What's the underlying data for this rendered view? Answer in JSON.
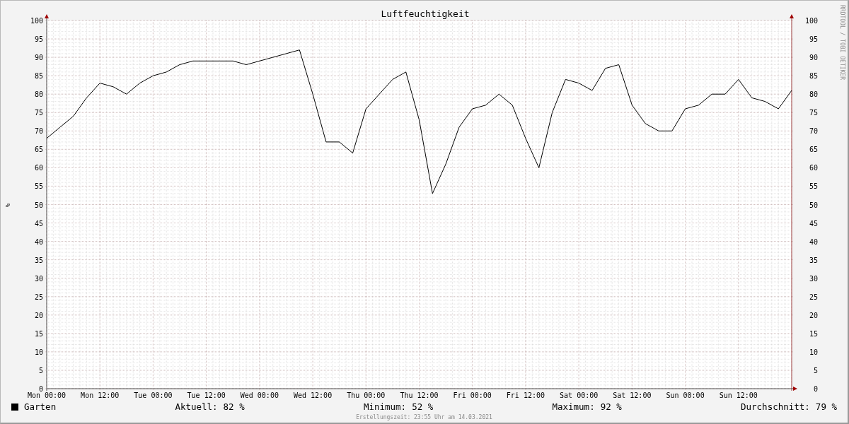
{
  "credit": "RRDTOOL / TOBI OETIKER",
  "chart_data": {
    "type": "line",
    "title": "Luftfeuchtigkeit",
    "ylabel": "%",
    "ylim": [
      0,
      100
    ],
    "grid": true,
    "yticks": [
      0,
      5,
      10,
      15,
      20,
      25,
      30,
      35,
      40,
      45,
      50,
      55,
      60,
      65,
      70,
      75,
      80,
      85,
      90,
      95,
      100
    ],
    "categories": [
      "Mon 00:00",
      null,
      null,
      null,
      "Mon 12:00",
      null,
      null,
      null,
      "Tue 00:00",
      null,
      null,
      null,
      "Tue 12:00",
      null,
      null,
      null,
      "Wed 00:00",
      null,
      null,
      null,
      "Wed 12:00",
      null,
      null,
      null,
      "Thu 00:00",
      null,
      null,
      null,
      "Thu 12:00",
      null,
      null,
      null,
      "Fri 00:00",
      null,
      null,
      null,
      "Fri 12:00",
      null,
      null,
      null,
      "Sat 00:00",
      null,
      null,
      null,
      "Sat 12:00",
      null,
      null,
      null,
      "Sun 00:00",
      null,
      null,
      null,
      "Sun 12:00",
      null,
      null,
      null,
      null
    ],
    "series": [
      {
        "name": "Garten",
        "color": "#000000",
        "values": [
          68,
          71,
          74,
          79,
          83,
          82,
          80,
          83,
          85,
          86,
          88,
          89,
          89,
          89,
          89,
          88,
          89,
          90,
          91,
          92,
          80,
          67,
          67,
          64,
          76,
          80,
          84,
          86,
          73,
          53,
          61,
          71,
          76,
          77,
          80,
          77,
          68,
          60,
          75,
          84,
          83,
          81,
          87,
          88,
          77,
          72,
          70,
          70,
          76,
          77,
          80,
          80,
          84,
          79,
          78,
          76,
          81
        ]
      }
    ]
  },
  "right_axis_labels": [
    "100",
    "95",
    "90",
    "85",
    "80",
    "75",
    "70",
    "65",
    "60",
    "55",
    "50",
    "45",
    "40",
    "35",
    "30",
    "25",
    "20",
    "15",
    "10",
    "5",
    "0"
  ],
  "legend": [
    {
      "label": "Aktuell:",
      "value": "82 %"
    },
    {
      "label": "Minimum:",
      "value": "52 %"
    },
    {
      "label": "Maximum:",
      "value": "92 %"
    },
    {
      "label": "Durchschnitt:",
      "value": "79 %"
    }
  ],
  "footer": "Erstellungszeit: 23:55 Uhr am 14.03.2021"
}
